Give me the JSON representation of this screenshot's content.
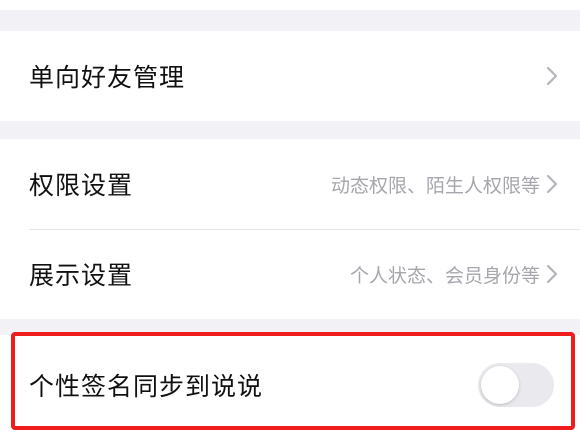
{
  "rows": {
    "one_way_friends": {
      "label": "单向好友管理"
    },
    "permissions": {
      "label": "权限设置",
      "value": "动态权限、陌生人权限等"
    },
    "display": {
      "label": "展示设置",
      "value": "个人状态、会员身份等"
    },
    "signature_sync": {
      "label": "个性签名同步到说说",
      "enabled": false
    }
  },
  "icons": {
    "chevron": "chevron-right-icon",
    "toggle": "toggle-switch"
  },
  "colors": {
    "background": "#f2f2f6",
    "highlight": "#ee1c1c",
    "secondary_text": "#a6a6ad"
  }
}
